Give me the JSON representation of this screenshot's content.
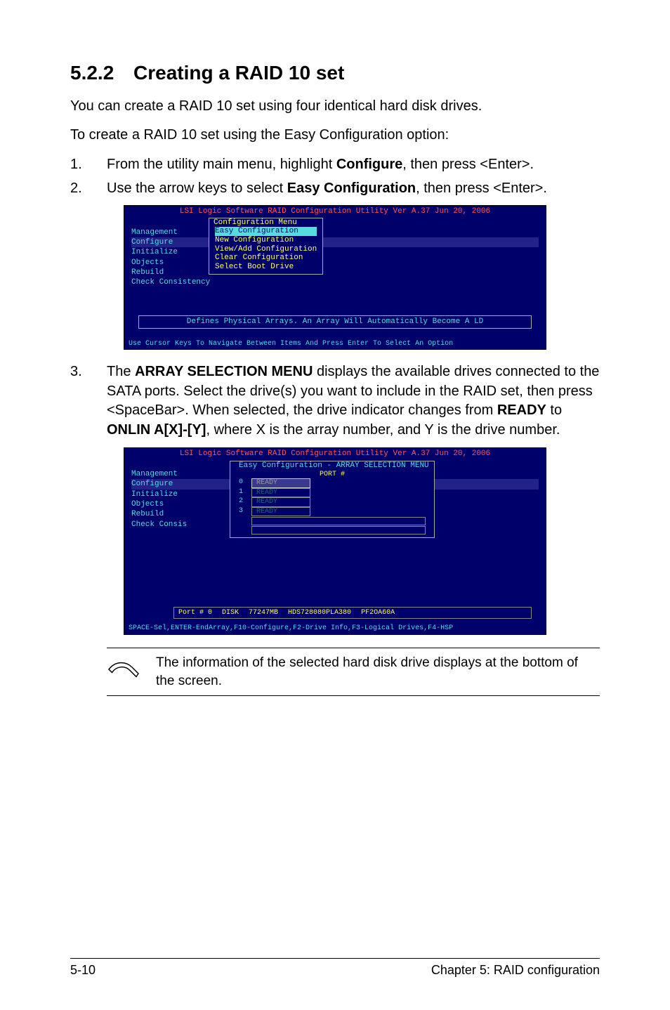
{
  "section": {
    "number": "5.2.2",
    "title": "Creating a RAID 10 set"
  },
  "intro": {
    "p1": "You can create a RAID 10 set using four identical hard disk drives.",
    "p2": "To create a RAID 10 set using the Easy Configuration option:"
  },
  "steps12": [
    {
      "n": "1.",
      "pre": "From the utility main menu, highlight ",
      "bold": "Configure",
      "post": ", then press <Enter>."
    },
    {
      "n": "2.",
      "pre": "Use the arrow keys to select ",
      "bold": "Easy Configuration",
      "post": ", then press <Enter>."
    }
  ],
  "term1": {
    "title": "LSI Logic Software RAID Configuration Utility Ver A.37 Jun 20, 2006",
    "menu": [
      "Management",
      "Configure",
      "Initialize",
      "Objects",
      "Rebuild",
      "Check Consistency"
    ],
    "cfg_title": "Configuration Menu",
    "cfg_items": [
      "Easy Configuration",
      "New Configuration",
      "View/Add Configuration",
      "Clear Configuration",
      "Select Boot Drive"
    ],
    "msg": "Defines Physical Arrays. An Array Will Automatically Become A LD",
    "footer": "Use Cursor Keys To Navigate Between Items And Press Enter To Select An Option"
  },
  "step3": {
    "n": "3.",
    "t1": "The ",
    "b1": "ARRAY SELECTION MENU",
    "t2": " displays the available drives connected to the SATA ports. Select the drive(s) you want to include in the RAID set, then press <SpaceBar>. When selected, the drive indicator changes from ",
    "b2": "READY",
    "t3": " to ",
    "b3": "ONLIN A[X]-[Y]",
    "t4": ", where X is the array number, and Y is the drive number."
  },
  "term2": {
    "title": "LSI Logic Software RAID Configuration Utility Ver A.37 Jun 20, 2006",
    "menu": [
      "Management",
      "Configure",
      "Initialize",
      "Objects",
      "Rebuild",
      "Check Consis"
    ],
    "arr_title": "Easy Configuration - ARRAY SELECTION MENU",
    "port_hdr": "PORT #",
    "drives": [
      {
        "id": "0",
        "status": "READY",
        "sel": true
      },
      {
        "id": "1",
        "status": "READY",
        "sel": false
      },
      {
        "id": "2",
        "status": "READY",
        "sel": false
      },
      {
        "id": "3",
        "status": "READY",
        "sel": false
      }
    ],
    "info": {
      "port": "Port # 0",
      "disk": "DISK",
      "size": "77247MB",
      "model": "HDS728080PLA380",
      "rev": "PF2OA60A"
    },
    "footer": "SPACE-Sel,ENTER-EndArray,F10-Configure,F2-Drive Info,F3-Logical Drives,F4-HSP"
  },
  "note": "The information of the selected hard disk drive displays at the bottom of the screen.",
  "footer": {
    "left": "5-10",
    "right": "Chapter 5: RAID configuration"
  }
}
